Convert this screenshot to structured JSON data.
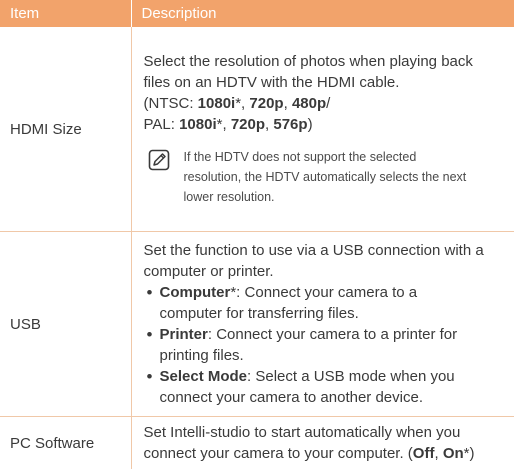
{
  "header": {
    "item": "Item",
    "description": "Description"
  },
  "hdmi": {
    "item": "HDMI Size",
    "desc1": "Select the resolution of photos when playing back",
    "desc2": "files on an HDTV with the HDMI cable.",
    "ntsc_prefix": "(NTSC: ",
    "ntsc_1": "1080i",
    "ntsc_star": "*, ",
    "ntsc_2": "720p",
    "comma": ", ",
    "ntsc_3": "480p",
    "slash": "/",
    "pal_prefix": "PAL: ",
    "pal_1": "1080i",
    "pal_star": "*, ",
    "pal_2": "720p",
    "pal_comma": ", ",
    "pal_3": "576p",
    "close": ")",
    "note1": "If the HDTV does not support the selected",
    "note2": "resolution, the HDTV automatically selects the next",
    "note3": "lower resolution.",
    "note_icon": "note-pencil-icon"
  },
  "usb": {
    "item": "USB",
    "desc1": "Set the function to use via a USB connection with a",
    "desc2": "computer or printer.",
    "computer_label": "Computer",
    "computer_rest1": "*: Connect your camera to a",
    "computer_rest2": "computer for transferring files.",
    "printer_label": "Printer",
    "printer_rest1": ": Connect your camera to a printer for",
    "printer_rest2": "printing files.",
    "select_label": "Select Mode",
    "select_rest1": ": Select a USB mode when you",
    "select_rest2": "connect your camera to another device."
  },
  "pc": {
    "item": "PC Software",
    "desc1": "Set Intelli-studio to start automatically when you",
    "desc2": "connect your camera to your computer. (",
    "off": "Off",
    "sep": ", ",
    "on": "On",
    "end": "*)"
  },
  "colors": {
    "header_bg": "#f2a36b",
    "divider": "#f0c8a8",
    "text": "#3a3a3a"
  }
}
